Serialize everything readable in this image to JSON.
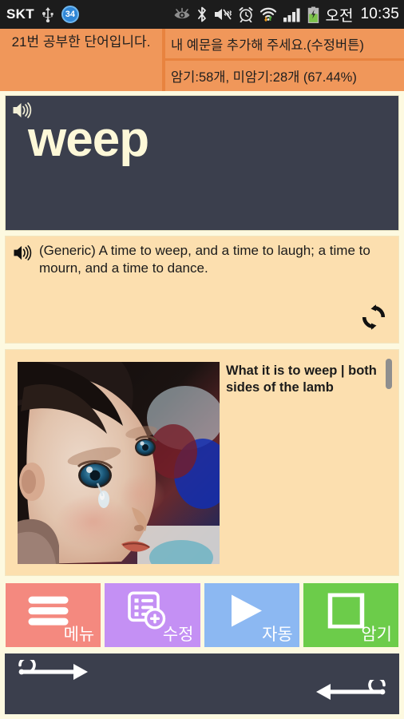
{
  "statusbar": {
    "carrier": "SKT",
    "badge_count": "34",
    "icons": [
      "usb-icon",
      "notification-count-badge",
      "eye-icon",
      "bluetooth-icon",
      "mute-vibrate-icon",
      "alarm-clock-icon",
      "wifi-icon",
      "signal-bars-icon",
      "battery-charging-icon"
    ],
    "ampm": "오전",
    "time": "10:35"
  },
  "header": {
    "study_count": "21번 공부한 단어입니다.",
    "add_example_hint": "내 예문을 추가해 주세요.(수정버튼)",
    "memorize_stats": "암기:58개, 미암기:28개 (67.44%)"
  },
  "word_panel": {
    "word": "weep",
    "speaker_icon": "speaker-icon"
  },
  "example_panel": {
    "speaker_icon": "speaker-icon",
    "sentence": "(Generic) A time to weep, and a time to laugh; a time to mourn, and a time to dance.",
    "refresh_icon": "refresh-icon"
  },
  "article_panel": {
    "title": "What it is to weep | both sides of the lamb",
    "thumbnail_alt": "crying-baby-photo"
  },
  "buttons": [
    {
      "label": "메뉴",
      "icon": "hamburger-menu-icon",
      "color": "#f4897f",
      "name": "menu-button"
    },
    {
      "label": "수정",
      "icon": "edit-add-list-icon",
      "color": "#c490f4",
      "name": "edit-button"
    },
    {
      "label": "자동",
      "icon": "play-icon",
      "color": "#8cb8f2",
      "name": "auto-button"
    },
    {
      "label": "암기",
      "icon": "square-outline-icon",
      "color": "#6ccc4a",
      "name": "memorize-button"
    }
  ],
  "nav": {
    "next_icon": "arrow-right-circle-icon",
    "prev_icon": "arrow-left-circle-icon"
  },
  "colors": {
    "page_bg": "#fdf9e0",
    "header_bg": "#e8833f",
    "header_panel": "#f0975a",
    "dark_panel": "#3b3f4d",
    "card_bg": "#fcdfaf",
    "word_text": "#fdf8d8"
  }
}
